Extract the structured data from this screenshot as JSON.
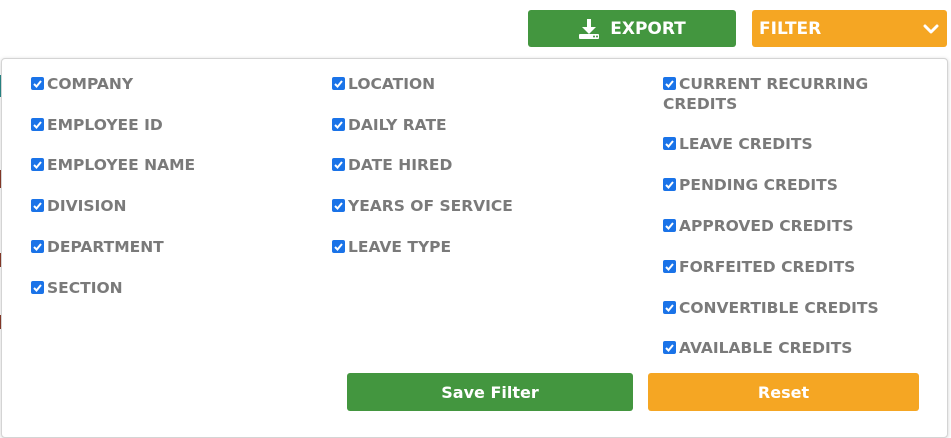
{
  "toolbar": {
    "export_label": "EXPORT",
    "filter_label": "FILTER",
    "export_icon": "download-icon",
    "filter_icon": "chevron-down-icon"
  },
  "columns": {
    "col1": [
      "COMPANY",
      "EMPLOYEE ID",
      "EMPLOYEE NAME",
      "DIVISION",
      "DEPARTMENT",
      "SECTION"
    ],
    "col2": [
      "LOCATION",
      "DAILY RATE",
      "DATE HIRED",
      "YEARS OF SERVICE",
      "LEAVE TYPE"
    ],
    "col3": [
      "CURRENT RECURRING CREDITS",
      "LEAVE CREDITS",
      "PENDING CREDITS",
      "APPROVED CREDITS",
      "FORFEITED CREDITS",
      "CONVERTIBLE CREDITS",
      "AVAILABLE CREDITS"
    ]
  },
  "checked": true,
  "actions": {
    "save_label": "Save Filter",
    "reset_label": "Reset"
  },
  "colors": {
    "green": "#43963f",
    "orange": "#f5a623",
    "checkbox": "#1a73e8",
    "label": "#7a7a7a"
  }
}
